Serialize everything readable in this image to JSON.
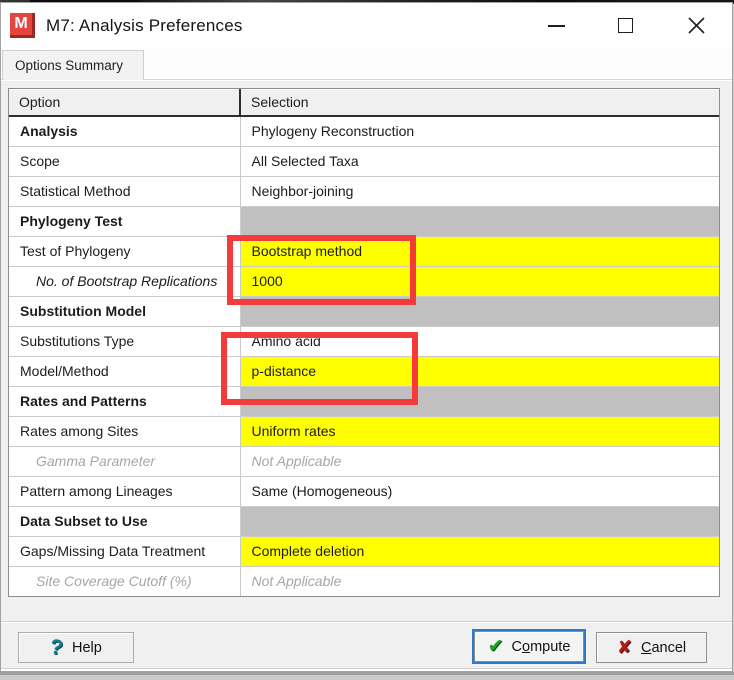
{
  "colors": {
    "highlight_yellow": "#ffff00",
    "section_gray": "#c0c0c0",
    "annotation_red": "#f53a3a",
    "focus_border_blue": "#2a7ad4",
    "help_icon_teal": "#0f7f92",
    "check_green": "#1ea11e",
    "cancel_x_red": "#b51a1a",
    "app_icon_red": "#e4453d"
  },
  "window": {
    "title": "M7: Analysis Preferences",
    "icon_letter": "M",
    "controls": [
      {
        "name": "minimize"
      },
      {
        "name": "maximize"
      },
      {
        "name": "close",
        "glyph": "✕"
      }
    ]
  },
  "tabs": [
    {
      "label": "Options Summary",
      "selected": true
    }
  ],
  "table": {
    "headers": {
      "option": "Option",
      "selection": "Selection"
    },
    "rows": [
      {
        "option": "Analysis",
        "selection": "Phylogeny Reconstruction",
        "option_bold": true,
        "selection_bg": "white"
      },
      {
        "option": "Scope",
        "selection": "All Selected Taxa",
        "selection_bg": "white"
      },
      {
        "option": "Statistical Method",
        "selection": "Neighbor-joining",
        "selection_bg": "white"
      },
      {
        "option": "Phylogeny Test",
        "selection": "",
        "option_bold": true,
        "selection_bg": "gray",
        "section": true
      },
      {
        "option": "Test of Phylogeny",
        "selection": "Bootstrap method",
        "selection_bg": "yellow"
      },
      {
        "option": "No. of Bootstrap Replications",
        "selection": "1000",
        "option_italic": true,
        "indent": true,
        "selection_bg": "yellow"
      },
      {
        "option": "Substitution Model",
        "selection": "",
        "option_bold": true,
        "selection_bg": "gray",
        "section": true
      },
      {
        "option": "Substitutions Type",
        "selection": "Amino acid",
        "selection_bg": "white"
      },
      {
        "option": "Model/Method",
        "selection": "p-distance",
        "selection_bg": "yellow"
      },
      {
        "option": "Rates and Patterns",
        "selection": "",
        "option_bold": true,
        "selection_bg": "gray",
        "section": true
      },
      {
        "option": "Rates among Sites",
        "selection": "Uniform rates",
        "selection_bg": "yellow"
      },
      {
        "option": "Gamma Parameter",
        "selection": "Not Applicable",
        "option_italic": true,
        "indent": true,
        "muted": true,
        "selection_bg": "white"
      },
      {
        "option": "Pattern among Lineages",
        "selection": "Same (Homogeneous)",
        "selection_bg": "white"
      },
      {
        "option": "Data Subset to Use",
        "selection": "",
        "option_bold": true,
        "selection_bg": "gray",
        "section": true
      },
      {
        "option": "Gaps/Missing Data Treatment",
        "selection": "Complete deletion",
        "selection_bg": "yellow"
      },
      {
        "option": "Site Coverage Cutoff (%)",
        "selection": "Not Applicable",
        "option_italic": true,
        "indent": true,
        "muted": true,
        "selection_bg": "white"
      }
    ]
  },
  "annotations": [
    {
      "name": "red-box-bootstrap",
      "around": [
        "Bootstrap method",
        "1000"
      ]
    },
    {
      "name": "red-box-model",
      "around": [
        "Amino acid",
        "p-distance"
      ]
    }
  ],
  "footer": {
    "help": {
      "glyph": "?",
      "label": "Help"
    },
    "compute": {
      "glyph": "✔",
      "pre": "C",
      "accel": "o",
      "post": "mpute"
    },
    "cancel": {
      "glyph": "✘",
      "pre": "",
      "accel": "C",
      "post": "ancel"
    }
  }
}
